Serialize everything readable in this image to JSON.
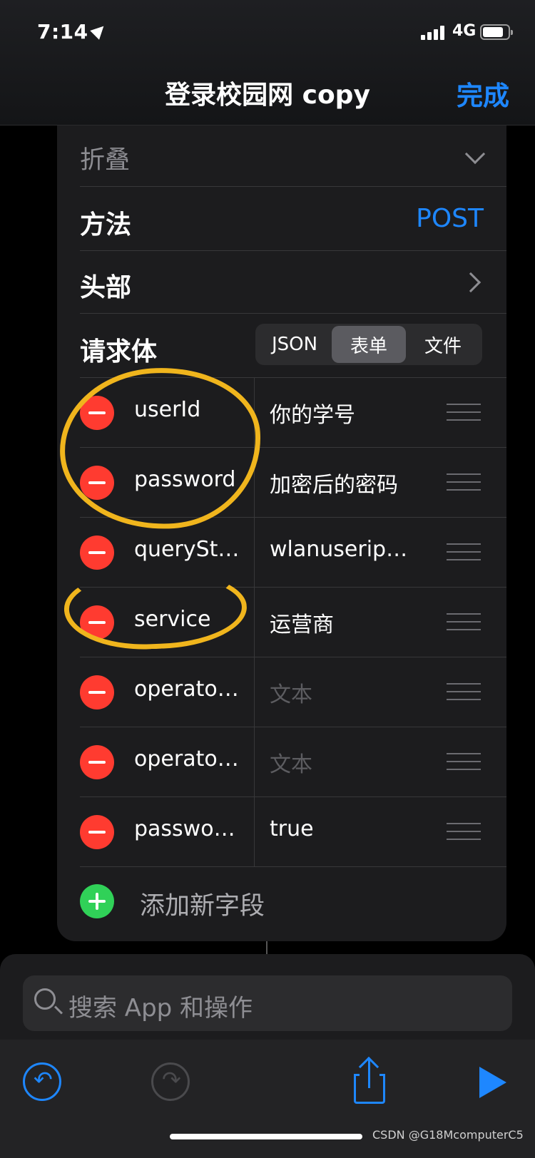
{
  "status_bar": {
    "time": "7:14",
    "network": "4G"
  },
  "nav": {
    "title": "登录校园网 copy",
    "done": "完成"
  },
  "card": {
    "collapse_label": "折叠",
    "method_label": "方法",
    "method_value": "POST",
    "headers_label": "头部",
    "body_label": "请求体",
    "segments": [
      {
        "label": "JSON",
        "active": false
      },
      {
        "label": "表单",
        "active": true
      },
      {
        "label": "文件",
        "active": false
      }
    ],
    "fields": [
      {
        "key": "userId",
        "value": "你的学号",
        "placeholder": false
      },
      {
        "key": "password",
        "value": "加密后的密码",
        "placeholder": false
      },
      {
        "key": "queryStri...",
        "value": "wlanuserip%...",
        "placeholder": false
      },
      {
        "key": "service",
        "value": "运营商",
        "placeholder": false
      },
      {
        "key": "operator...",
        "value": "文本",
        "placeholder": true
      },
      {
        "key": "operator...",
        "value": "文本",
        "placeholder": true
      },
      {
        "key": "password...",
        "value": "true",
        "placeholder": false
      }
    ],
    "add_field": "添加新字段"
  },
  "search": {
    "placeholder": "搜索 App 和操作"
  },
  "watermark": "CSDN @G18McomputerC5",
  "colors": {
    "accent": "#1e87ff",
    "delete": "#ff3b30",
    "add": "#30d158",
    "annotation": "#f0b51d"
  }
}
